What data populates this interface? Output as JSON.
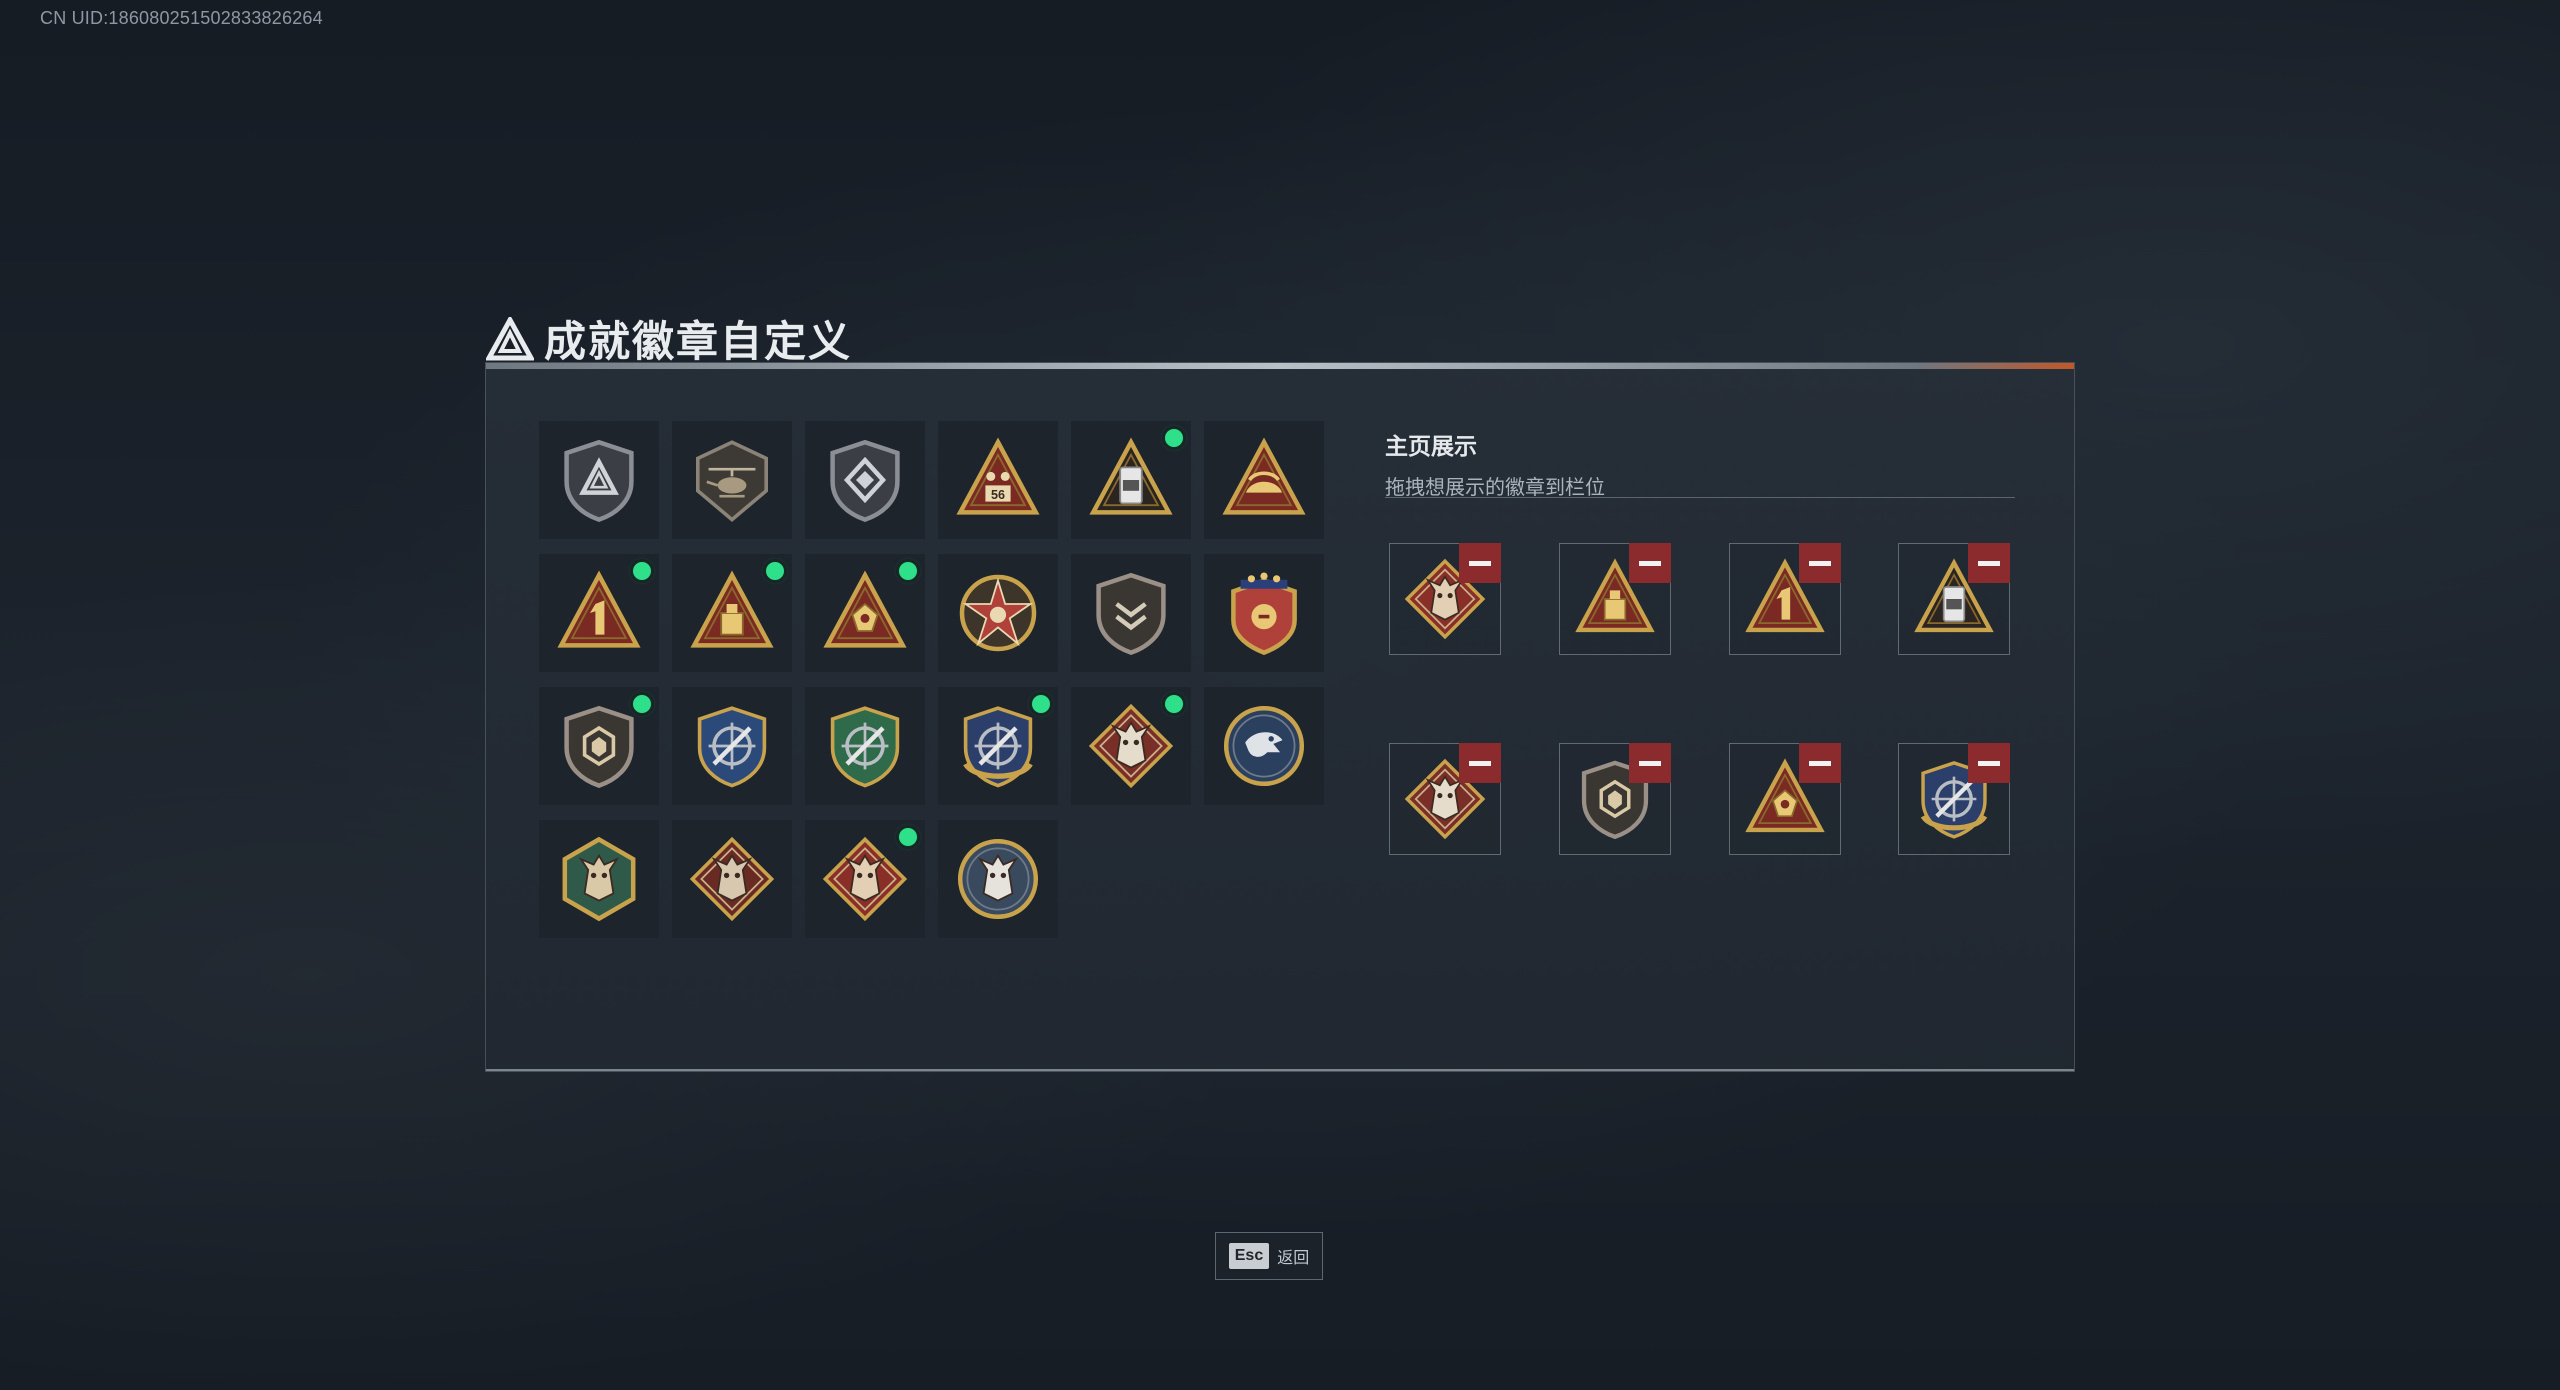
{
  "uid_label": "CN UID:1860802515028338262​64",
  "header": {
    "title": "成就徽章自定义",
    "icon": "delta-logo-icon"
  },
  "badges": [
    {
      "icon": "delta-shield-badge-icon",
      "new": false
    },
    {
      "icon": "helicopter-shield-badge-icon",
      "new": false
    },
    {
      "icon": "diamond-shield-badge-icon",
      "new": false
    },
    {
      "icon": "triangle-56-badge-icon",
      "new": false
    },
    {
      "icon": "triangle-canister-badge-icon",
      "new": true
    },
    {
      "icon": "triangle-hands-badge-icon",
      "new": false
    },
    {
      "icon": "triangle-number-one-badge-icon",
      "new": true
    },
    {
      "icon": "triangle-crate-badge-icon",
      "new": true
    },
    {
      "icon": "triangle-crest-badge-icon",
      "new": true
    },
    {
      "icon": "star-medal-badge-icon",
      "new": false
    },
    {
      "icon": "chevron-shield-badge-icon",
      "new": false
    },
    {
      "icon": "stars-shield-badge-icon",
      "new": false
    },
    {
      "icon": "hexagon-shield-badge-icon",
      "new": true
    },
    {
      "icon": "blue-crosshair-badge-icon",
      "new": false
    },
    {
      "icon": "green-crosshair-badge-icon",
      "new": false
    },
    {
      "icon": "gold-crosshair-badge-icon",
      "new": true
    },
    {
      "icon": "wolf-diamond-badge-icon",
      "new": true
    },
    {
      "icon": "eagle-circle-badge-icon",
      "new": false
    },
    {
      "icon": "dragon-hexagon-badge-icon",
      "new": false
    },
    {
      "icon": "dragon-diamond-badge-icon",
      "new": false
    },
    {
      "icon": "dragon-diamond-red-badge-icon",
      "new": true
    },
    {
      "icon": "wolf-circle-badge-icon",
      "new": false
    }
  ],
  "display": {
    "title": "主页展示",
    "subtitle": "拖拽想展示的徽章到栏位",
    "slots": [
      {
        "icon": "dragon-diamond-red-badge-icon"
      },
      {
        "icon": "triangle-crate-badge-icon"
      },
      {
        "icon": "triangle-number-one-badge-icon"
      },
      {
        "icon": "triangle-canister-badge-icon"
      },
      {
        "icon": "wolf-diamond-badge-icon"
      },
      {
        "icon": "hexagon-shield-badge-icon"
      },
      {
        "icon": "triangle-crest-badge-icon"
      },
      {
        "icon": "gold-crosshair-badge-icon"
      }
    ]
  },
  "footer": {
    "esc_key": "Esc",
    "esc_label": "返回"
  },
  "colors": {
    "background": "#161c24",
    "panel": "#262e38",
    "accent_orange": "#c0582a",
    "new_dot": "#2fe08a",
    "remove_button": "#8c2b2e",
    "gold": "#c9a24c"
  }
}
